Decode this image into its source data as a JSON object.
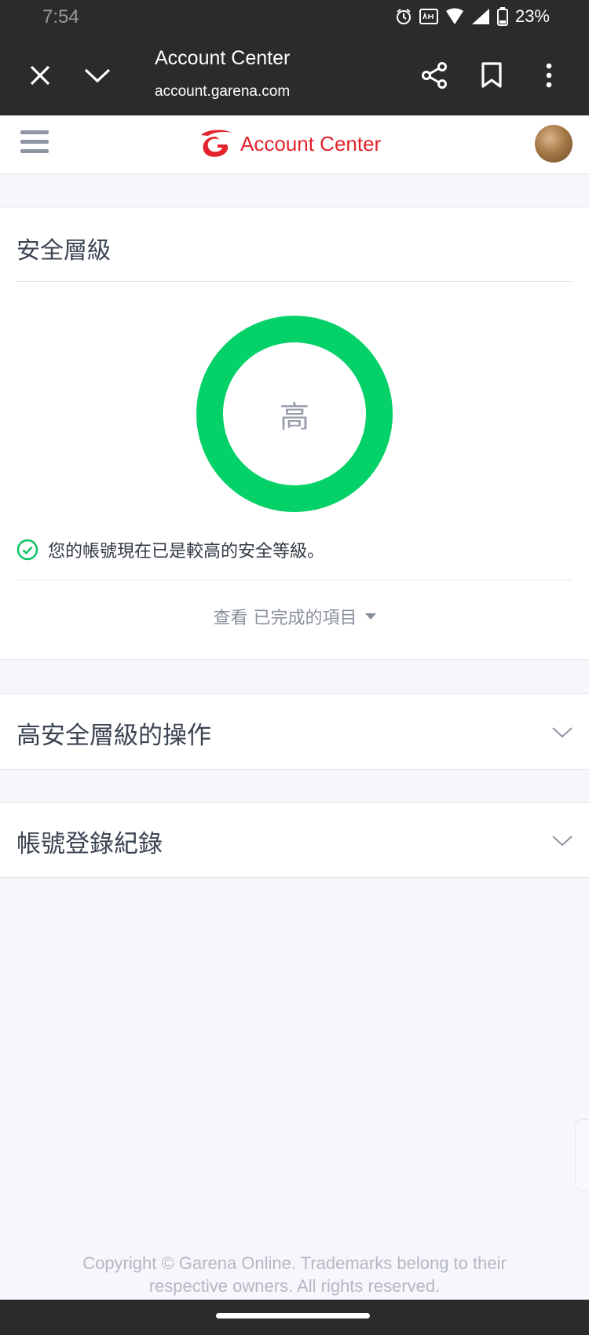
{
  "status_bar": {
    "time": "7:54",
    "battery": "23%",
    "icons": [
      "alarm-icon",
      "auto-hd-icon",
      "wifi-icon",
      "signal-icon",
      "battery-icon"
    ]
  },
  "browser": {
    "title": "Account Center",
    "url": "account.garena.com",
    "icons": [
      "close-icon",
      "chevron-down-icon",
      "share-icon",
      "bookmark-icon",
      "more-icon"
    ]
  },
  "site": {
    "brand": "Account Center",
    "brand_color": "#e2232b",
    "icons": [
      "hamburger-menu-icon",
      "garena-logo",
      "avatar"
    ]
  },
  "security": {
    "heading": "安全層級",
    "level": "高",
    "ring_color": "#04d167",
    "status_message": "您的帳號現在已是較高的安全等級。",
    "view_completed_link": "查看 已完成的項目"
  },
  "sections": [
    {
      "title": "高安全層級的操作"
    },
    {
      "title": "帳號登錄紀錄"
    }
  ],
  "footer": {
    "copyright_line1": "Copyright © Garena Online. Trademarks belong to their",
    "copyright_line2": "respective owners. All rights reserved."
  }
}
